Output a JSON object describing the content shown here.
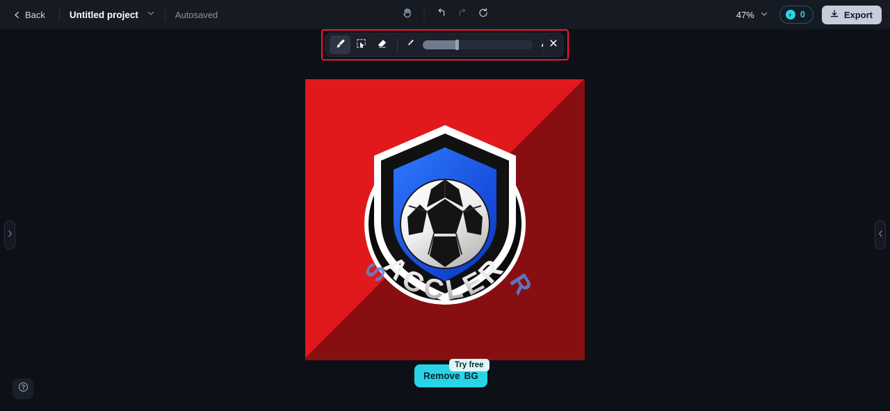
{
  "header": {
    "back_label": "Back",
    "project_name": "Untitled project",
    "autosaved_label": "Autosaved",
    "zoom_level": "47%",
    "credits_count": "0",
    "export_label": "Export",
    "center_tools": [
      {
        "name": "hand-tool",
        "label": "Hand"
      },
      {
        "name": "undo",
        "label": "Undo"
      },
      {
        "name": "redo",
        "label": "Redo"
      },
      {
        "name": "reset",
        "label": "Reset"
      }
    ]
  },
  "toolbar": {
    "tools": [
      {
        "name": "brush",
        "label": "Brush",
        "active": true
      },
      {
        "name": "magic-select",
        "label": "Select",
        "active": false
      },
      {
        "name": "eraser",
        "label": "Eraser",
        "active": false
      }
    ],
    "brush_size_min_label": "Small brush",
    "brush_size_max_label": "Large brush",
    "brush_size_percent": "31",
    "close_label": "Close"
  },
  "canvas": {
    "background_color": "#e2191c",
    "shield_outer_color": "#101010",
    "shield_inner_color": "#1f63ef",
    "shield_rim_color": "#ffffff",
    "ring_color": "#0a0a0a",
    "curved_text": "ACCLER",
    "side_letter_left": "S",
    "side_letter_right": "R"
  },
  "actions": {
    "remove_label": "Remove",
    "remove_badge": "BG",
    "tooltip_label": "Try free"
  },
  "panels": {
    "left_handle_label": "Open left panel",
    "right_handle_label": "Open right panel",
    "help_label": "Help"
  },
  "colors": {
    "accent_cyan": "#2ad4e8",
    "highlight_red": "#fc1330",
    "header_bg": "#161a23",
    "app_bg": "#0d1017"
  }
}
